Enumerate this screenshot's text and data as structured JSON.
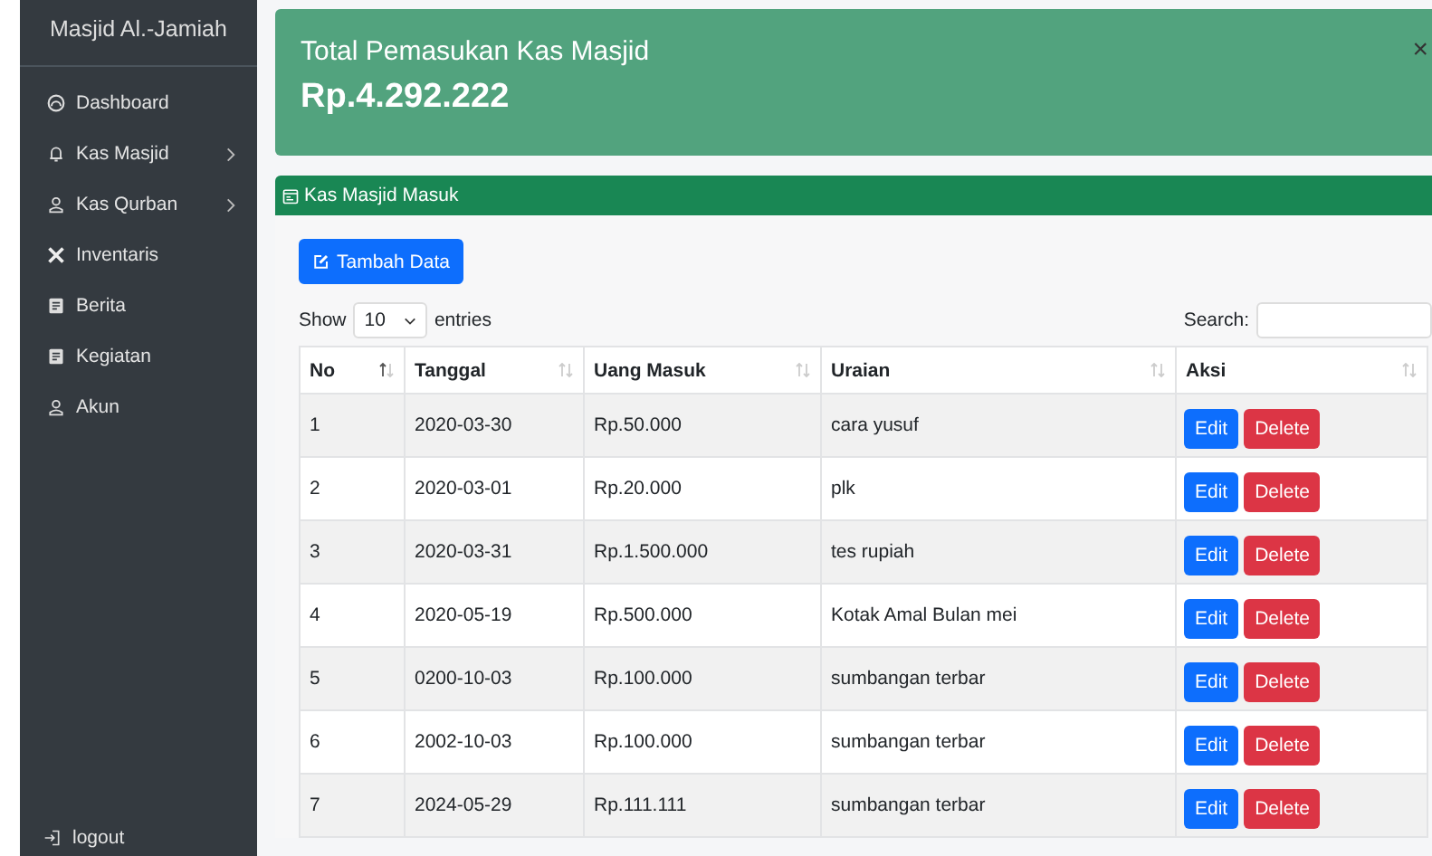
{
  "sidebar": {
    "brand": "Masjid Al.-Jamiah",
    "items": [
      {
        "label": "Dashboard",
        "kind": "gauge",
        "has_submenu": false
      },
      {
        "label": "Kas Masjid",
        "kind": "bell",
        "has_submenu": true
      },
      {
        "label": "Kas Qurban",
        "kind": "user",
        "has_submenu": true
      },
      {
        "label": "Inventaris",
        "kind": "tools",
        "has_submenu": false
      },
      {
        "label": "Berita",
        "kind": "doc",
        "has_submenu": false
      },
      {
        "label": "Kegiatan",
        "kind": "doc",
        "has_submenu": false
      },
      {
        "label": "Akun",
        "kind": "user",
        "has_submenu": false
      }
    ],
    "logout": "logout"
  },
  "total_card": {
    "title": "Total Pemasukan Kas Masjid",
    "amount": "Rp.4.292.222",
    "close": "×"
  },
  "panel": {
    "title": "Kas Masjid Masuk",
    "add_button": "Tambah Data",
    "length": {
      "show": "Show",
      "value": "10",
      "entries": "entries"
    },
    "search_label": "Search:",
    "table": {
      "columns": [
        {
          "label": "No",
          "sorted": true
        },
        {
          "label": "Tanggal",
          "sorted": false
        },
        {
          "label": "Uang Masuk",
          "sorted": false
        },
        {
          "label": "Uraian",
          "sorted": false
        },
        {
          "label": "Aksi",
          "sorted": false
        }
      ],
      "rows": [
        {
          "no": "1",
          "tanggal": "2020-03-30",
          "uang": "Rp.50.000",
          "uraian": "cara yusuf",
          "edit": "Edit",
          "delete": "Delete"
        },
        {
          "no": "2",
          "tanggal": "2020-03-01",
          "uang": "Rp.20.000",
          "uraian": "plk",
          "edit": "Edit",
          "delete": "Delete"
        },
        {
          "no": "3",
          "tanggal": "2020-03-31",
          "uang": "Rp.1.500.000",
          "uraian": "tes rupiah",
          "edit": "Edit",
          "delete": "Delete"
        },
        {
          "no": "4",
          "tanggal": "2020-05-19",
          "uang": "Rp.500.000",
          "uraian": "Kotak Amal Bulan mei",
          "edit": "Edit",
          "delete": "Delete"
        },
        {
          "no": "5",
          "tanggal": "0200-10-03",
          "uang": "Rp.100.000",
          "uraian": "sumbangan terbar",
          "edit": "Edit",
          "delete": "Delete"
        },
        {
          "no": "6",
          "tanggal": "2002-10-03",
          "uang": "Rp.100.000",
          "uraian": "sumbangan terbar",
          "edit": "Edit",
          "delete": "Delete"
        },
        {
          "no": "7",
          "tanggal": "2024-05-29",
          "uang": "Rp.111.111",
          "uraian": "sumbangan terbar",
          "edit": "Edit",
          "delete": "Delete"
        }
      ]
    }
  }
}
